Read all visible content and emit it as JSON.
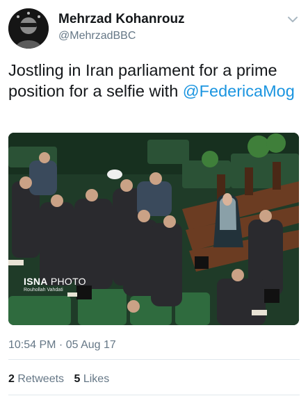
{
  "author": {
    "display_name": "Mehrzad Kohanrouz",
    "handle": "@MehrzadBBC",
    "avatar_icon": "profile-avatar"
  },
  "tweet": {
    "text_before": "Jostling in Iran parliament for a prime position for a selfie with ",
    "mention": "@FedericaMog",
    "mention_color": "#1b95e0"
  },
  "photo": {
    "watermark_brand": "ISNA",
    "watermark_word": " PHOTO",
    "watermark_credit": "Rouhollah Vahdati"
  },
  "meta": {
    "timestamp": "10:54 PM · 05 Aug 17"
  },
  "stats": {
    "retweets_count": "2",
    "retweets_label": " Retweets",
    "likes_count": "5",
    "likes_label": " Likes"
  },
  "icons": {
    "menu": "chevron-down-icon"
  }
}
